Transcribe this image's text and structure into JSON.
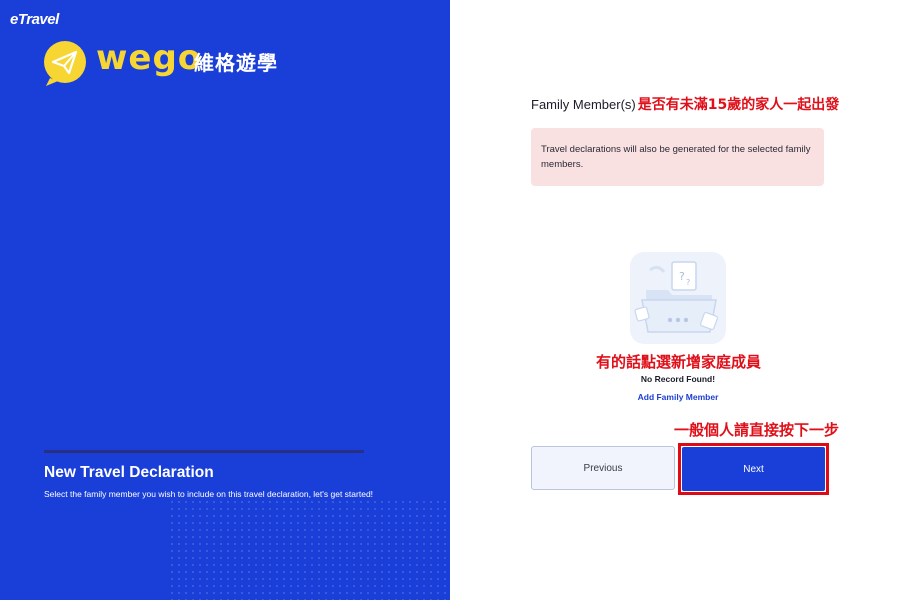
{
  "brand": {
    "etravel_logo": "eTravel",
    "wego_wordmark": "wego",
    "wego_chinese": "維格遊學",
    "colors": {
      "panel_blue": "#1a3fd9",
      "wego_yellow": "#f7d633",
      "annotation_red": "#e0101a"
    }
  },
  "intro": {
    "title": "New Travel Declaration",
    "subtitle": "Select the family member you wish to include on this travel declaration, let's get started!"
  },
  "family": {
    "heading": "Family Member(s)",
    "info_text": "Travel declarations will also be generated for the selected family members.",
    "empty_text": "No Record Found!",
    "add_link": "Add Family Member",
    "illustration_icon": "empty-folder-icon"
  },
  "annotations": {
    "heading_note": "是否有未滿15歲的家人一起出發",
    "add_note": "有的話點選新增家庭成員",
    "next_note": "一般個人請直接按下一步"
  },
  "buttons": {
    "previous": "Previous",
    "next": "Next"
  }
}
